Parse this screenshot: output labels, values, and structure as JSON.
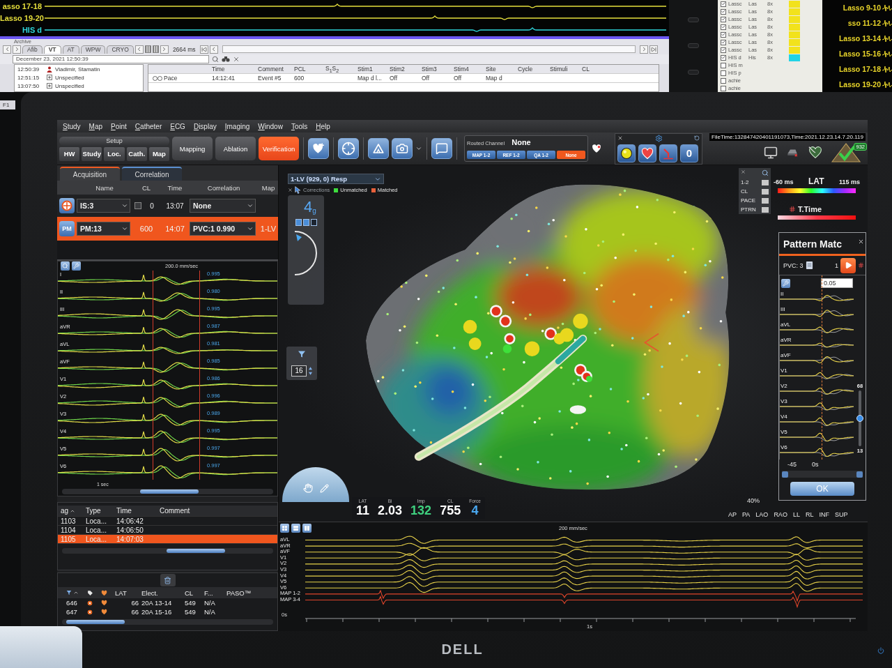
{
  "background_left_monitor": {
    "channels": [
      {
        "label": "asso 17-18",
        "color": "#e6df3c"
      },
      {
        "label": "Lasso 19-20",
        "color": "#e6df3c"
      },
      {
        "label": "HIS d",
        "color": "#2fd6dc"
      }
    ],
    "archive_label": "Archive",
    "archive_tabs": [
      {
        "label": "Afib",
        "selected": false
      },
      {
        "label": "VT",
        "selected": true
      },
      {
        "label": "AT",
        "selected": false
      },
      {
        "label": "WPW",
        "selected": false
      },
      {
        "label": "CRYO",
        "selected": false
      }
    ],
    "duration": "2664 ms",
    "date_field": "December 23, 2021  12:50:39",
    "sessions": [
      {
        "time": "12:50:39",
        "name": "Vladimir, Stamatin",
        "kind": "patient"
      },
      {
        "time": "12:51:15",
        "name": "Unspecified",
        "kind": "study"
      },
      {
        "time": "13:07:50",
        "name": "Unspecified",
        "kind": "study"
      }
    ],
    "event_columns": [
      "Time",
      "Comment",
      "PCL",
      "S$_{1}$S$_{2}$",
      "Stim1",
      "Stim2",
      "Stim3",
      "Stim4",
      "Site",
      "Cycle",
      "Stimuli",
      "CL"
    ],
    "event_rows": [
      {
        "type": "Pace",
        "time": "14:12:41",
        "comment": "Event #5",
        "pcl": "600",
        "stim1": "Map d l...",
        "stim2": "Off",
        "stim3": "Off",
        "stim4": "Off",
        "site": "Map d"
      }
    ],
    "function_key": "F1"
  },
  "background_right_monitor": {
    "rows": [
      {
        "checked": true,
        "name": "Lassc",
        "label": "Las",
        "gain": "8x",
        "color": "#f2e21c"
      },
      {
        "checked": true,
        "name": "Lassc",
        "label": "Las",
        "gain": "8x",
        "color": "#f2e21c"
      },
      {
        "checked": true,
        "name": "Lassc",
        "label": "Las",
        "gain": "8x",
        "color": "#f2e21c"
      },
      {
        "checked": true,
        "name": "Lassc",
        "label": "Las",
        "gain": "8x",
        "color": "#f2e21c"
      },
      {
        "checked": true,
        "name": "Lassc",
        "label": "Las",
        "gain": "8x",
        "color": "#f2e21c"
      },
      {
        "checked": true,
        "name": "Lassc",
        "label": "Las",
        "gain": "8x",
        "color": "#f2e21c"
      },
      {
        "checked": true,
        "name": "Lassc",
        "label": "Las",
        "gain": "8x",
        "color": "#f2e21c"
      },
      {
        "checked": true,
        "name": "HIS d",
        "label": "His",
        "gain": "8x",
        "color": "#22d3e6"
      },
      {
        "checked": false,
        "name": "HIS m"
      },
      {
        "checked": false,
        "name": "HIS p"
      },
      {
        "checked": false,
        "name": "achie"
      },
      {
        "checked": false,
        "name": "achie"
      }
    ],
    "labels": [
      "Lasso 9-10",
      "sso 11-12",
      "Lasso 13-14",
      "Lasso 15-16",
      "Lasso 17-18",
      "Lasso 19-20"
    ]
  },
  "menu": [
    "Study",
    "Map",
    "Point",
    "Catheter",
    "ECG",
    "Display",
    "Imaging",
    "Window",
    "Tools",
    "Help"
  ],
  "toolbar": {
    "setup_label": "Setup",
    "setup_buttons": [
      "HW",
      "Study",
      "Loc.",
      "Cath.",
      "Map"
    ],
    "modes": [
      {
        "label": "Mapping",
        "selected": false
      },
      {
        "label": "Ablation",
        "selected": false
      },
      {
        "label": "Verification",
        "selected": true
      }
    ],
    "routed_channel": {
      "label": "Routed Channel",
      "value": "None",
      "channels": [
        {
          "label": "MAP 1-2",
          "selected": false
        },
        {
          "label": "REF 1-2",
          "selected": false
        },
        {
          "label": "QA 1-2",
          "selected": false
        },
        {
          "label": "None",
          "selected": true
        }
      ]
    },
    "display_counter": "0",
    "file_time": "FileTime:132847420401191073,Time:2021.12.23.14.7.20.119",
    "point_count": "932"
  },
  "left_panel": {
    "tabs": [
      {
        "label": "Acquisition",
        "selected": true
      },
      {
        "label": "Correlation",
        "selected": false
      }
    ],
    "columns": [
      "Name",
      "CL",
      "Time",
      "Correlation",
      "Map"
    ],
    "rows": [
      {
        "kind": "is",
        "name": "IS:3",
        "checked": false,
        "cl": "0",
        "time": "13:07",
        "correlation": "None",
        "selected": false
      },
      {
        "kind": "pm",
        "badge": "PM",
        "name": "PM:13",
        "cl": "600",
        "time": "14:07",
        "correlation": "PVC:1  0.990",
        "map": "1-LV",
        "selected": true
      }
    ],
    "ecg": {
      "speed": "200.0 mm/sec",
      "scale": "1 sec",
      "leads": [
        {
          "name": "I",
          "score": "0.995"
        },
        {
          "name": "II",
          "score": "0.980"
        },
        {
          "name": "III",
          "score": "0.995"
        },
        {
          "name": "aVR",
          "score": "0.987"
        },
        {
          "name": "aVL",
          "score": "0.981"
        },
        {
          "name": "aVF",
          "score": "0.985"
        },
        {
          "name": "V1",
          "score": "0.986"
        },
        {
          "name": "V2",
          "score": "0.996"
        },
        {
          "name": "V3",
          "score": "0.989"
        },
        {
          "name": "V4",
          "score": "0.995"
        },
        {
          "name": "V5",
          "score": "0.997"
        },
        {
          "name": "V6",
          "score": "0.997"
        }
      ]
    },
    "events": {
      "columns": [
        "ag",
        "Type",
        "Time",
        "Comment"
      ],
      "rows": [
        {
          "tag": "1103",
          "type": "Loca...",
          "time": "14:06:42",
          "selected": false
        },
        {
          "tag": "1104",
          "type": "Loca...",
          "time": "14:06:50",
          "selected": false
        },
        {
          "tag": "1105",
          "type": "Loca...",
          "time": "14:07:03",
          "selected": true
        }
      ]
    },
    "points": {
      "columns": [
        "LAT",
        "Elect.",
        "CL",
        "F...",
        "PASO™"
      ],
      "rows": [
        {
          "id": "646",
          "lat": "66",
          "elect": "20A 13-14",
          "cl": "549",
          "f": "N/A"
        },
        {
          "id": "647",
          "lat": "66",
          "elect": "20A 15-16",
          "cl": "549",
          "f": "N/A"
        }
      ]
    }
  },
  "map_view": {
    "map_selector": "1-LV (929, 0) Resp",
    "corrections_label": "Corrections",
    "legend": [
      {
        "label": "Unmatched",
        "color": "#3ddc3d"
      },
      {
        "label": "Matched",
        "color": "#e8603a"
      }
    ],
    "force": {
      "value": "4",
      "unit": "g"
    },
    "counter": "16",
    "side_labels": [
      "1-2",
      "CL",
      "PACE",
      "PTRN"
    ],
    "readouts": [
      {
        "label": "LAT",
        "value": "11",
        "color": "#ffffff"
      },
      {
        "label": "Bi",
        "value": "2.03",
        "color": "#ffffff"
      },
      {
        "label": "Imp",
        "value": "132",
        "color": "#3fd17f"
      },
      {
        "label": "CL",
        "value": "755",
        "color": "#ffffff"
      },
      {
        "label": "Force",
        "value": "4",
        "color": "#4aa8f0"
      }
    ],
    "transparency": "40%",
    "views": [
      "AP",
      "PA",
      "LAO",
      "RAO",
      "LL",
      "RL",
      "INF",
      "SUP"
    ]
  },
  "lat_legend": {
    "min": "-60 ms",
    "title": "LAT",
    "max": "115 ms",
    "t_time": "T.Time"
  },
  "pattern_match": {
    "title": "Pattern Matc",
    "pvc_label": "PVC: 3",
    "index": "1",
    "threshold": "0.05",
    "leads": [
      "II",
      "III",
      "aVL",
      "aVR",
      "aVF",
      "V1",
      "V2",
      "V3",
      "V4",
      "V5",
      "V6"
    ],
    "min_label": "-45",
    "time_label": "0s",
    "slider": {
      "max": "68",
      "value": "13",
      "level": 0.5
    },
    "ok": "OK"
  },
  "ecg_strip": {
    "speed": "200 mm/sec",
    "leads": [
      {
        "name": "aVL",
        "color": "#e8d24a"
      },
      {
        "name": "aVR",
        "color": "#e8d24a"
      },
      {
        "name": "aVF",
        "color": "#e8d24a"
      },
      {
        "name": "V1",
        "color": "#e8d24a"
      },
      {
        "name": "V2",
        "color": "#e8d24a"
      },
      {
        "name": "V3",
        "color": "#e8d24a"
      },
      {
        "name": "V4",
        "color": "#e8d24a"
      },
      {
        "name": "V5",
        "color": "#e8d24a"
      },
      {
        "name": "V6",
        "color": "#e8d24a"
      },
      {
        "name": "MAP 1-2",
        "color": "#e0452b"
      },
      {
        "name": "MAP 3-4",
        "color": "#e0452b"
      }
    ],
    "ticks": [
      "0s",
      "1s"
    ]
  },
  "monitor": {
    "brand": "DELL"
  }
}
